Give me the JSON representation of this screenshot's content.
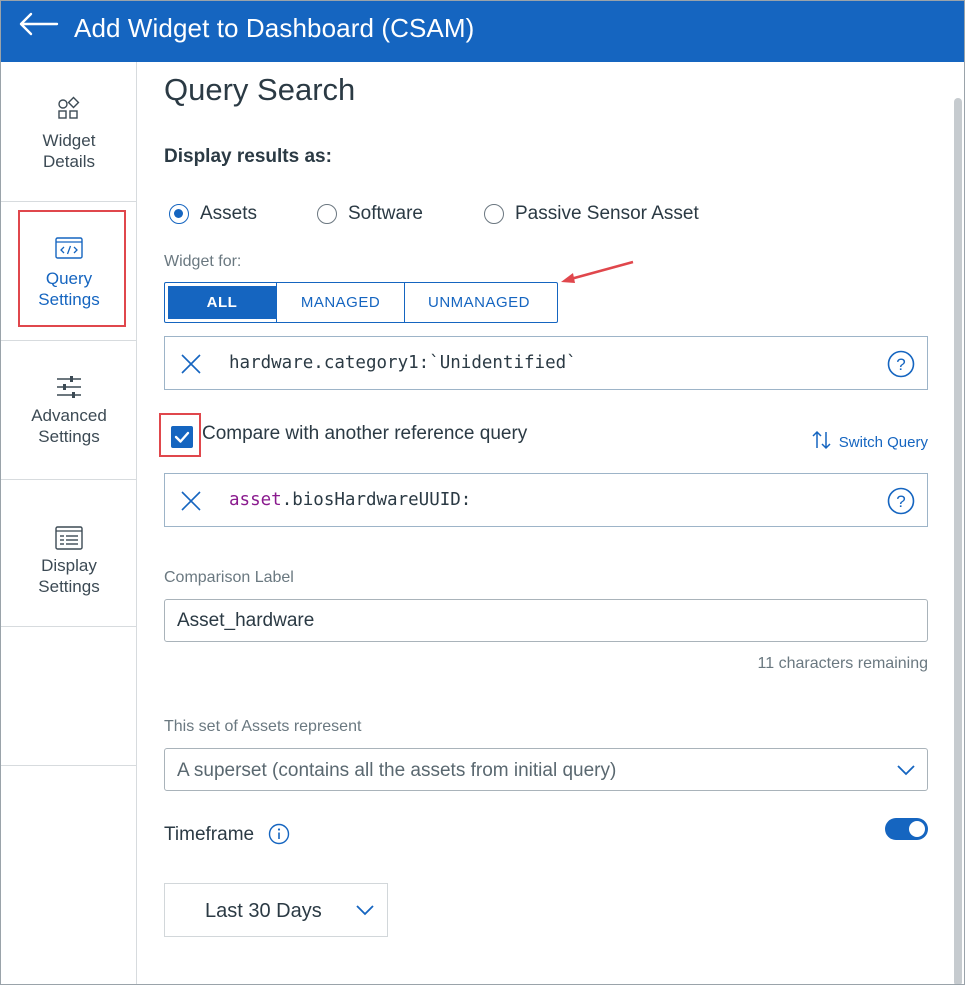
{
  "header": {
    "title": "Add Widget to Dashboard (CSAM)"
  },
  "sidebar": {
    "items": [
      {
        "line1": "Widget",
        "line2": "Details",
        "icon": "shapes-icon"
      },
      {
        "line1": "Query",
        "line2": "Settings",
        "icon": "code-icon",
        "active": true
      },
      {
        "line1": "Advanced",
        "line2": "Settings",
        "icon": "sliders-icon"
      },
      {
        "line1": "Display",
        "line2": "Settings",
        "icon": "layout-icon"
      }
    ]
  },
  "main": {
    "title": "Query Search",
    "display_results_label": "Display results as:",
    "radios": [
      {
        "label": "Assets",
        "checked": true
      },
      {
        "label": "Software",
        "checked": false
      },
      {
        "label": "Passive Sensor Asset",
        "checked": false
      }
    ],
    "widget_for_label": "Widget for:",
    "widget_for_options": [
      "ALL",
      "MANAGED",
      "UNMANAGED"
    ],
    "widget_for_selected": "ALL",
    "query1": "hardware.category1:`Unidentified`",
    "compare_label": "Compare with another reference query",
    "switch_query_label": "Switch Query",
    "query2_keyword": "asset",
    "query2_rest": ".biosHardwareUUID:",
    "comparison_label_title": "Comparison Label",
    "comparison_label_value": "Asset_hardware",
    "chars_remaining": "11 characters remaining",
    "set_label": "This set of Assets represent",
    "set_value": "A superset (contains all the assets from initial query)",
    "timeframe_label": "Timeframe",
    "timeframe_enabled": true,
    "timeframe_value": "Last 30 Days"
  },
  "colors": {
    "brand": "#1565c0",
    "highlight": "#e0474c"
  }
}
